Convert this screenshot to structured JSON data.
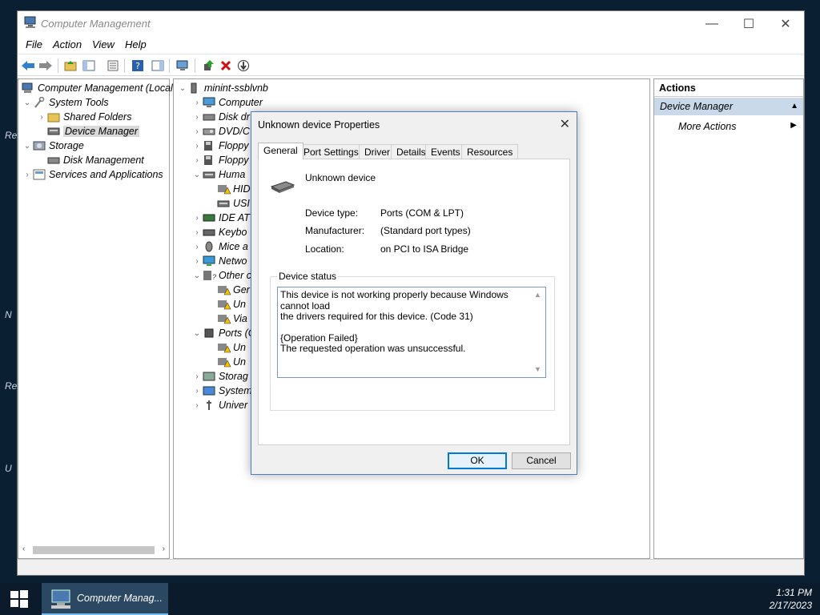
{
  "window": {
    "title": "Computer Management",
    "menu": [
      "File",
      "Action",
      "View",
      "Help"
    ]
  },
  "left_tree": {
    "items": [
      {
        "label": "Computer Management (Local"
      },
      {
        "label": "System Tools"
      },
      {
        "label": "Shared Folders"
      },
      {
        "label": "Device Manager"
      },
      {
        "label": "Storage"
      },
      {
        "label": "Disk Management"
      },
      {
        "label": "Services and Applications"
      }
    ]
  },
  "device_tree": {
    "root": "minint-ssblvnb",
    "items": [
      {
        "label": "Computer"
      },
      {
        "label": "Disk dr"
      },
      {
        "label": "DVD/C"
      },
      {
        "label": "Floppy"
      },
      {
        "label": "Floppy"
      },
      {
        "label": "Huma"
      },
      {
        "label": "HID"
      },
      {
        "label": "USI"
      },
      {
        "label": "IDE AT"
      },
      {
        "label": "Keybo"
      },
      {
        "label": "Mice a"
      },
      {
        "label": "Netwo"
      },
      {
        "label": "Other c"
      },
      {
        "label": "Ger"
      },
      {
        "label": "Un"
      },
      {
        "label": "Via"
      },
      {
        "label": "Ports (C"
      },
      {
        "label": "Un"
      },
      {
        "label": "Un"
      },
      {
        "label": "Storag"
      },
      {
        "label": "System"
      },
      {
        "label": "Univer"
      }
    ]
  },
  "actions": {
    "header": "Actions",
    "section": "Device Manager",
    "more": "More Actions"
  },
  "dialog": {
    "title": "Unknown device Properties",
    "tabs": [
      "General",
      "Port Settings",
      "Driver",
      "Details",
      "Events",
      "Resources"
    ],
    "device_name": "Unknown device",
    "props": [
      {
        "label": "Device type:",
        "value": "Ports (COM & LPT)"
      },
      {
        "label": "Manufacturer:",
        "value": "(Standard port types)"
      },
      {
        "label": "Location:",
        "value": "on PCI to ISA Bridge"
      }
    ],
    "status_group": "Device status",
    "status_lines": [
      "This device is not working properly because Windows cannot load",
      "the drivers required for this device. (Code 31)",
      "",
      "{Operation Failed}",
      "The requested operation was unsuccessful."
    ],
    "ok": "OK",
    "cancel": "Cancel"
  },
  "desktop": {
    "stubs": [
      "Re",
      "N",
      "Re",
      "U"
    ]
  },
  "taskbar": {
    "app": "Computer Manag...",
    "time": "1:31 PM",
    "date": "2/17/2023"
  },
  "colors": {
    "accent": "#0078d7",
    "selected_action": "#c9d9ea",
    "taskbar": "#0c1b2c"
  }
}
